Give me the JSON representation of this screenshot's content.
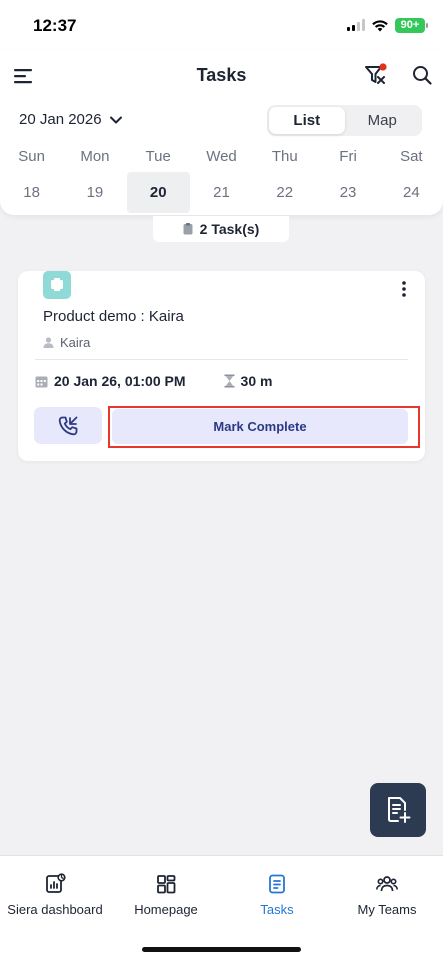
{
  "status_bar": {
    "time": "12:37",
    "battery": "90+"
  },
  "header": {
    "title": "Tasks"
  },
  "date_picker": {
    "label": "20 Jan 2026"
  },
  "view_toggle": {
    "list": "List",
    "map": "Map",
    "selected": "List"
  },
  "week": {
    "days": [
      "Sun",
      "Mon",
      "Tue",
      "Wed",
      "Thu",
      "Fri",
      "Sat"
    ],
    "dates": [
      "18",
      "19",
      "20",
      "21",
      "22",
      "23",
      "24"
    ],
    "selected": "20"
  },
  "task_count": "2 Task(s)",
  "task": {
    "title": "Product demo : Kaira",
    "assignee": "Kaira",
    "datetime": "20 Jan 26, 01:00 PM",
    "duration": "30 m",
    "mark_complete_label": "Mark Complete"
  },
  "bottom_nav": {
    "items": [
      {
        "label": "Siera dashboard",
        "icon": "dashboard-icon"
      },
      {
        "label": "Homepage",
        "icon": "grid-icon"
      },
      {
        "label": "Tasks",
        "icon": "tasks-icon",
        "active": true
      },
      {
        "label": "My Teams",
        "icon": "team-icon"
      }
    ]
  },
  "colors": {
    "accent": "#2277d6",
    "button_bg": "#e7e8fb",
    "button_text": "#2c3a86",
    "highlight": "#e5372b",
    "fab_bg": "#2c3a52",
    "filter_dot": "#e0301e"
  }
}
